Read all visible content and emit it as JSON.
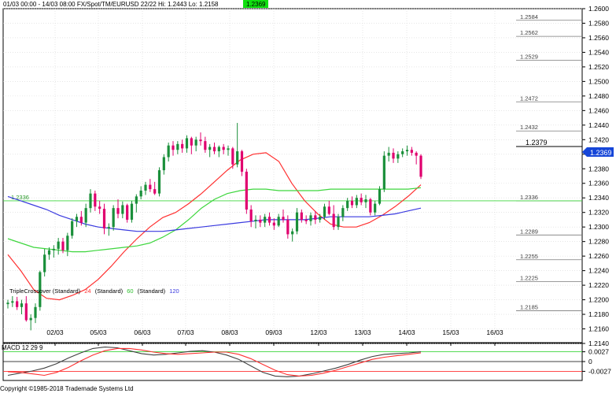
{
  "header": {
    "title": "01/03 00:00 - 14/03 08:00  FX/Spot/TM/EURUSD 22/22  Hi: 1.2443  Lo: 1.2158",
    "last_price": "1.2369"
  },
  "colors": {
    "up_candle": "#1a8f3a",
    "down_candle": "#e0006e",
    "ma_short": "#ff3030",
    "ma_mid": "#3ed63e",
    "ma_long": "#3a3adf",
    "price_badge": "#1646d8",
    "macd_line": "#404040",
    "signal_line": "#ff3030"
  },
  "indicator_legend": {
    "name": "TripleCrossover (Standard)",
    "p1": "24",
    "p1_label": "(Standard)",
    "p2": "60",
    "p2_label": "(Standard)",
    "p3": "120"
  },
  "macd": {
    "label": "MACD 12 29 9",
    "levels": [
      "0.0027",
      "0",
      "-0.0027"
    ]
  },
  "footer": {
    "copyright": "Copyright ©1985-2018 Trademade Systems Ltd"
  },
  "price_axis": {
    "ticks": [
      "1.2600",
      "1.2580",
      "1.2560",
      "1.2540",
      "1.2520",
      "1.2500",
      "1.2480",
      "1.2460",
      "1.2440",
      "1.2420",
      "1.2400",
      "1.2380",
      "1.2360",
      "1.2340",
      "1.2320",
      "1.2300",
      "1.2280",
      "1.2260",
      "1.2240",
      "1.2220",
      "1.2200",
      "1.2180",
      "1.2160",
      "1.2140"
    ],
    "current_price": "1.2369",
    "crosshair_price": "1.2379"
  },
  "chart_data": {
    "type": "candlestick",
    "x_ticks": [
      "02/03",
      "05/03",
      "06/03",
      "07/03",
      "08/03",
      "09/03",
      "12/03",
      "13/03",
      "14/03",
      "15/03",
      "16/03"
    ],
    "ylim": [
      1.214,
      1.26
    ],
    "grid": true,
    "levels": [
      "1.2584",
      "1.2562",
      "1.2529",
      "1.2472",
      "1.2432",
      "1.2336",
      "1.2289",
      "1.2255",
      "1.2225",
      "1.2185"
    ],
    "left_level": "1.2336",
    "ohlc": [
      [
        1.2194,
        1.22,
        1.2188,
        1.2196
      ],
      [
        1.2196,
        1.2205,
        1.219,
        1.2198
      ],
      [
        1.2198,
        1.2204,
        1.2186,
        1.219
      ],
      [
        1.219,
        1.22,
        1.218,
        1.2195
      ],
      [
        1.2195,
        1.2205,
        1.217,
        1.2172
      ],
      [
        1.2172,
        1.218,
        1.2158,
        1.2175
      ],
      [
        1.2175,
        1.2195,
        1.2168,
        1.219
      ],
      [
        1.219,
        1.224,
        1.2185,
        1.2238
      ],
      [
        1.2238,
        1.227,
        1.2232,
        1.2262
      ],
      [
        1.2262,
        1.2272,
        1.2255,
        1.2268
      ],
      [
        1.2268,
        1.2275,
        1.2258,
        1.227
      ],
      [
        1.227,
        1.2285,
        1.2262,
        1.228
      ],
      [
        1.228,
        1.2285,
        1.2264,
        1.2268
      ],
      [
        1.2268,
        1.2292,
        1.226,
        1.2288
      ],
      [
        1.2288,
        1.2312,
        1.2284,
        1.2308
      ],
      [
        1.2308,
        1.2318,
        1.23,
        1.2314
      ],
      [
        1.2314,
        1.2322,
        1.2302,
        1.2306
      ],
      [
        1.2306,
        1.2332,
        1.23,
        1.2326
      ],
      [
        1.2326,
        1.2352,
        1.232,
        1.2346
      ],
      [
        1.2346,
        1.235,
        1.2322,
        1.2328
      ],
      [
        1.2328,
        1.2336,
        1.2318,
        1.2325
      ],
      [
        1.2325,
        1.2332,
        1.229,
        1.2298
      ],
      [
        1.2298,
        1.2305,
        1.2288,
        1.23
      ],
      [
        1.23,
        1.233,
        1.2295,
        1.2326
      ],
      [
        1.2326,
        1.2338,
        1.2312,
        1.2318
      ],
      [
        1.2318,
        1.2335,
        1.2312,
        1.233
      ],
      [
        1.233,
        1.2332,
        1.2306,
        1.231
      ],
      [
        1.231,
        1.2336,
        1.2306,
        1.2332
      ],
      [
        1.2332,
        1.2345,
        1.232,
        1.2342
      ],
      [
        1.2342,
        1.2356,
        1.2338,
        1.235
      ],
      [
        1.235,
        1.2362,
        1.2344,
        1.2358
      ],
      [
        1.2358,
        1.2366,
        1.2348,
        1.2352
      ],
      [
        1.2352,
        1.2362,
        1.2344,
        1.2346
      ],
      [
        1.2346,
        1.2382,
        1.2342,
        1.2378
      ],
      [
        1.2378,
        1.24,
        1.2372,
        1.2396
      ],
      [
        1.2396,
        1.2416,
        1.239,
        1.2412
      ],
      [
        1.2412,
        1.2418,
        1.2398,
        1.2406
      ],
      [
        1.2406,
        1.2418,
        1.24,
        1.2414
      ],
      [
        1.2414,
        1.242,
        1.2402,
        1.2408
      ],
      [
        1.2408,
        1.2426,
        1.2402,
        1.2422
      ],
      [
        1.2422,
        1.2424,
        1.24,
        1.2412
      ],
      [
        1.2412,
        1.2424,
        1.2404,
        1.242
      ],
      [
        1.242,
        1.243,
        1.2412,
        1.2418
      ],
      [
        1.2418,
        1.2424,
        1.2402,
        1.2406
      ],
      [
        1.2406,
        1.2414,
        1.2396,
        1.241
      ],
      [
        1.241,
        1.2416,
        1.24,
        1.2404
      ],
      [
        1.2404,
        1.2412,
        1.2396,
        1.241
      ],
      [
        1.241,
        1.2414,
        1.24,
        1.2406
      ],
      [
        1.2406,
        1.2412,
        1.2398,
        1.2408
      ],
      [
        1.2408,
        1.241,
        1.238,
        1.2386
      ],
      [
        1.2386,
        1.2443,
        1.2382,
        1.2404
      ],
      [
        1.2404,
        1.2406,
        1.237,
        1.2376
      ],
      [
        1.2376,
        1.238,
        1.2318,
        1.2324
      ],
      [
        1.2324,
        1.233,
        1.23,
        1.2308
      ],
      [
        1.2308,
        1.2316,
        1.2298,
        1.231
      ],
      [
        1.231,
        1.2316,
        1.23,
        1.2306
      ],
      [
        1.2306,
        1.2318,
        1.23,
        1.2314
      ],
      [
        1.2314,
        1.232,
        1.2302,
        1.2306
      ],
      [
        1.2306,
        1.2312,
        1.2296,
        1.2302
      ],
      [
        1.2302,
        1.2318,
        1.23,
        1.2314
      ],
      [
        1.2314,
        1.2324,
        1.2306,
        1.231
      ],
      [
        1.231,
        1.2316,
        1.2284,
        1.229
      ],
      [
        1.229,
        1.2298,
        1.228,
        1.2294
      ],
      [
        1.2294,
        1.2326,
        1.229,
        1.232
      ],
      [
        1.232,
        1.2324,
        1.2306,
        1.231
      ],
      [
        1.231,
        1.2316,
        1.2304,
        1.2308
      ],
      [
        1.2308,
        1.232,
        1.2302,
        1.2316
      ],
      [
        1.2316,
        1.2322,
        1.2304,
        1.231
      ],
      [
        1.231,
        1.2318,
        1.2306,
        1.2314
      ],
      [
        1.2314,
        1.2332,
        1.231,
        1.2328
      ],
      [
        1.2328,
        1.2336,
        1.2316,
        1.2318
      ],
      [
        1.2318,
        1.233,
        1.2296,
        1.23
      ],
      [
        1.23,
        1.2318,
        1.2296,
        1.2314
      ],
      [
        1.2314,
        1.233,
        1.2308,
        1.2326
      ],
      [
        1.2326,
        1.234,
        1.2322,
        1.2336
      ],
      [
        1.2336,
        1.2342,
        1.2326,
        1.233
      ],
      [
        1.233,
        1.2344,
        1.2326,
        1.234
      ],
      [
        1.234,
        1.2346,
        1.233,
        1.2334
      ],
      [
        1.2334,
        1.2344,
        1.2326,
        1.2338
      ],
      [
        1.2338,
        1.234,
        1.2316,
        1.232
      ],
      [
        1.232,
        1.2336,
        1.2316,
        1.2332
      ],
      [
        1.2332,
        1.2356,
        1.233,
        1.2352
      ],
      [
        1.2352,
        1.2404,
        1.2348,
        1.2398
      ],
      [
        1.2398,
        1.241,
        1.239,
        1.2402
      ],
      [
        1.2402,
        1.2408,
        1.2388,
        1.2394
      ],
      [
        1.2394,
        1.2404,
        1.2388,
        1.24
      ],
      [
        1.24,
        1.2408,
        1.2396,
        1.2404
      ],
      [
        1.2404,
        1.2412,
        1.2398,
        1.2406
      ],
      [
        1.2406,
        1.241,
        1.2398,
        1.2402
      ],
      [
        1.2402,
        1.2404,
        1.2386,
        1.2398
      ],
      [
        1.2398,
        1.24,
        1.2366,
        1.2369
      ]
    ],
    "series": [
      {
        "name": "24",
        "values": [
          1.2262,
          1.224,
          1.2214,
          1.2202,
          1.22,
          1.2206,
          1.2214,
          1.2228,
          1.2246,
          1.2266,
          1.2284,
          1.23,
          1.2313,
          1.232,
          1.2332,
          1.2346,
          1.2362,
          1.2378,
          1.2392,
          1.24,
          1.2402,
          1.239,
          1.236,
          1.2336,
          1.2318,
          1.2304,
          1.23,
          1.23,
          1.2306,
          1.2316,
          1.2328,
          1.2342,
          1.2358
        ]
      },
      {
        "name": "60",
        "values": [
          1.2284,
          1.2278,
          1.2272,
          1.227,
          1.2268,
          1.2266,
          1.2266,
          1.2268,
          1.227,
          1.2272,
          1.2274,
          1.2278,
          1.2286,
          1.2296,
          1.231,
          1.2326,
          1.2338,
          1.2346,
          1.235,
          1.2352,
          1.2352,
          1.235,
          1.235,
          1.235,
          1.235,
          1.2352,
          1.2352,
          1.2352,
          1.2352,
          1.2352,
          1.2352,
          1.2352,
          1.2354
        ]
      },
      {
        "name": "120",
        "values": [
          1.2342,
          1.2336,
          1.233,
          1.2324,
          1.2316,
          1.231,
          1.2304,
          1.23,
          1.2298,
          1.2296,
          1.2294,
          1.2294,
          1.2294,
          1.2296,
          1.2298,
          1.23,
          1.2302,
          1.2304,
          1.2306,
          1.2308,
          1.231,
          1.231,
          1.231,
          1.231,
          1.2312,
          1.2314,
          1.2314,
          1.2314,
          1.2314,
          1.2316,
          1.2318,
          1.2322,
          1.2326
        ]
      }
    ],
    "macd": {
      "ylim": [
        -0.005,
        0.005
      ],
      "macd_line": [
        -0.0038,
        -0.0032,
        -0.0026,
        -0.0018,
        -0.0006,
        0.001,
        0.0024,
        0.0036,
        0.004,
        0.0038,
        0.003,
        0.0022,
        0.0018,
        0.002,
        0.0024,
        0.0028,
        0.003,
        0.0026,
        0.0018,
        0.0006,
        -0.0012,
        -0.003,
        -0.004,
        -0.0042,
        -0.004,
        -0.0034,
        -0.0026,
        -0.0018,
        -0.0008,
        0.0004,
        0.0014,
        0.002,
        0.0022,
        0.0024,
        0.0027
      ],
      "signal_line": [
        -0.0028,
        -0.003,
        -0.0034,
        -0.0038,
        -0.003,
        -0.0016,
        0.0002,
        0.0018,
        0.003,
        0.0036,
        0.0036,
        0.0032,
        0.0026,
        0.0022,
        0.002,
        0.0022,
        0.0024,
        0.0026,
        0.0026,
        0.002,
        0.0008,
        -0.0008,
        -0.0024,
        -0.0036,
        -0.004,
        -0.0038,
        -0.0032,
        -0.0024,
        -0.0014,
        -0.0004,
        0.0006,
        0.0012,
        0.0016,
        0.002,
        0.0024
      ]
    }
  }
}
